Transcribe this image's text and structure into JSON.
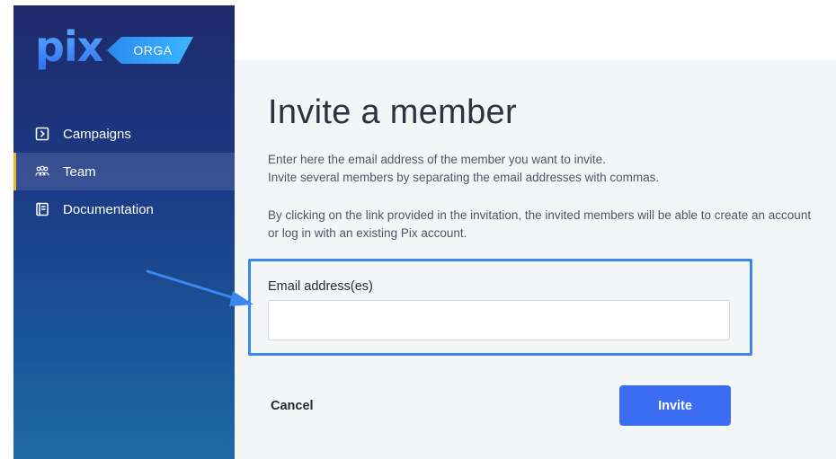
{
  "brand": {
    "logo_text": "pix",
    "badge": "ORGA"
  },
  "colors": {
    "accent": "#3b6cf2",
    "callout": "#3b87f1",
    "active_marker": "#f0b429",
    "sidebar_top": "#1e2a6b",
    "sidebar_bottom": "#1f6aa6"
  },
  "sidebar": {
    "items": [
      {
        "label": "Campaigns",
        "icon": "campaign-icon",
        "active": false
      },
      {
        "label": "Team",
        "icon": "team-icon",
        "active": true
      },
      {
        "label": "Documentation",
        "icon": "book-icon",
        "active": false
      }
    ]
  },
  "main": {
    "title": "Invite a member",
    "description_lines": [
      "Enter here the email address of the member you want to invite.",
      "Invite several members by separating the email addresses with commas."
    ],
    "note": "By clicking on the link provided in the invitation, the invited members will be able to create an account or log in with an existing Pix account.",
    "email_field": {
      "label": "Email address(es)",
      "value": "",
      "placeholder": ""
    },
    "cancel_label": "Cancel",
    "invite_label": "Invite"
  },
  "annotation": {
    "icon": "arrow-annotation-icon"
  }
}
